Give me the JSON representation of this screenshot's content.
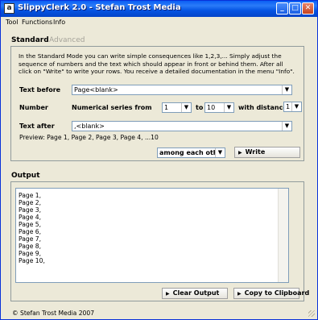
{
  "window": {
    "title": "SlippyClerk 2.0 - Stefan Trost Media",
    "app_icon_glyph": "a",
    "controls": {
      "minimize": "_",
      "maximize": "□",
      "close": "✕"
    },
    "accent": "#0554e3"
  },
  "menu": [
    "Tool",
    "Functions",
    "Info"
  ],
  "tabs": [
    {
      "label": "Standard",
      "active": true
    },
    {
      "label": "Advanced",
      "active": false
    }
  ],
  "intro": "In the Standard Mode you can write simple consequences like 1,2,3,... Simply adjust the sequence of numbers and the text which should appear in front or behind them. After all click on \"Write\" to write your rows. You receive a detailed documentation in the menu \"Info\".",
  "text_before": {
    "label": "Text before",
    "value": "Page<blank>"
  },
  "number": {
    "label": "Number",
    "series_label": "Numerical series from",
    "from_value": "1",
    "to_label": "to",
    "to_value": "10",
    "distance_label": "with distance:",
    "distance_value": "1"
  },
  "text_after": {
    "label": "Text after",
    "value": ",<blank>"
  },
  "preview": "Preview: Page 1, Page 2, Page 3, Page 4, ...10",
  "arrangement": {
    "value": "among each other"
  },
  "write_button": "Write",
  "output": {
    "label": "Output",
    "lines": [
      "Page 1,",
      "Page 2,",
      "Page 3,",
      "Page 4,",
      "Page 5,",
      "Page 6,",
      "Page 7,",
      "Page 8,",
      "Page 9,",
      "Page 10,"
    ]
  },
  "clear_button": "Clear Output",
  "copy_button": "Copy to Clipboard",
  "status": "© Stefan Trost Media 2007",
  "icons": {
    "dropdown": "chevron-down-icon",
    "button_marker": "triangle-right-icon"
  }
}
